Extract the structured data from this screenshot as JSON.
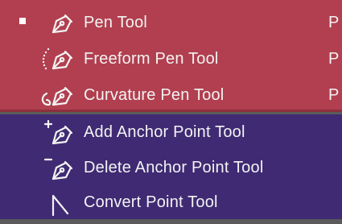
{
  "tool_flyout": {
    "groups": [
      {
        "color": "#b13f4f",
        "items": [
          {
            "label": "Pen Tool",
            "shortcut": "P",
            "icon": "pen-tool-icon",
            "selected": true
          },
          {
            "label": "Freeform Pen Tool",
            "shortcut": "P",
            "icon": "freeform-pen-tool-icon",
            "selected": false
          },
          {
            "label": "Curvature Pen Tool",
            "shortcut": "P",
            "icon": "curvature-pen-tool-icon",
            "selected": false
          }
        ]
      },
      {
        "color": "#3f2a73",
        "items": [
          {
            "label": "Add Anchor Point Tool",
            "icon": "add-anchor-point-icon"
          },
          {
            "label": "Delete Anchor Point Tool",
            "icon": "delete-anchor-point-icon"
          },
          {
            "label": "Convert Point Tool",
            "icon": "convert-point-icon"
          }
        ]
      }
    ]
  }
}
